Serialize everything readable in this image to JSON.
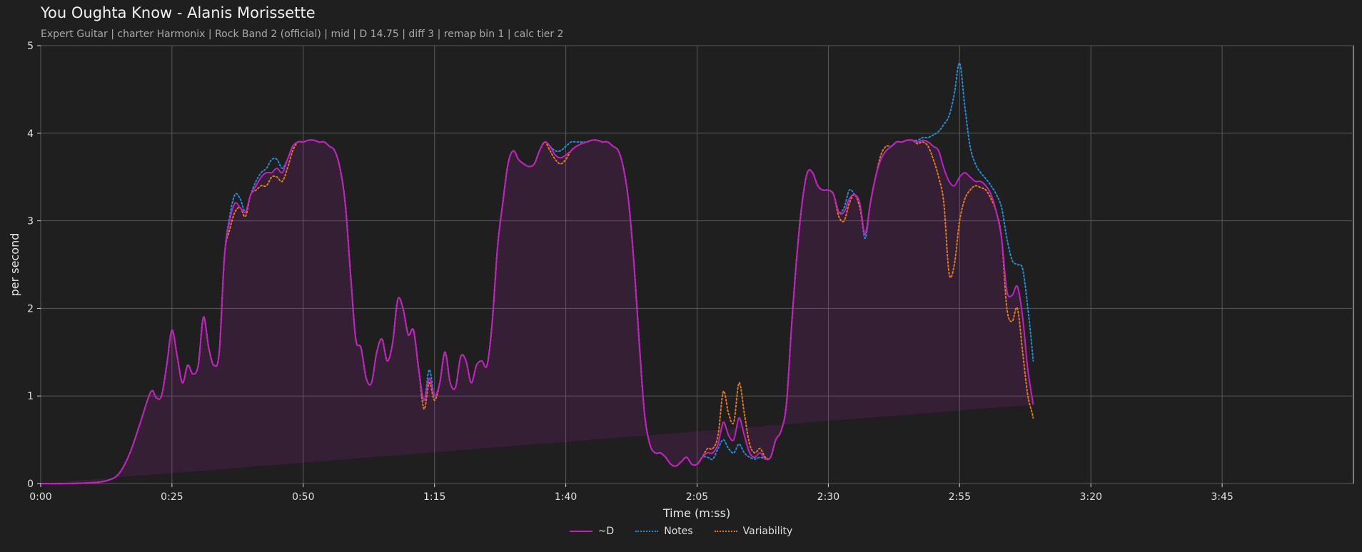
{
  "header": {
    "title": "You Oughta Know - Alanis Morissette",
    "subtitle": "Expert Guitar  |  charter Harmonix  |  Rock Band 2 (official)  |  mid  |  D 14.75  |  diff 3  |  remap bin 1  |  calc tier 2"
  },
  "chart_data": {
    "type": "line",
    "title": "You Oughta Know - Alanis Morissette",
    "xlabel": "Time (m:ss)",
    "ylabel": "per second",
    "xlim": [
      0,
      250
    ],
    "ylim": [
      0,
      5
    ],
    "x_ticks": [
      0,
      25,
      50,
      75,
      100,
      125,
      150,
      175,
      200,
      225
    ],
    "x_tick_labels": [
      "0:00",
      "0:25",
      "0:50",
      "1:15",
      "1:40",
      "2:05",
      "2:30",
      "2:55",
      "3:20",
      "3:45"
    ],
    "y_ticks": [
      0,
      1,
      2,
      3,
      4,
      5
    ],
    "y_tick_labels": [
      "0",
      "1",
      "2",
      "3",
      "4",
      "5"
    ],
    "grid": true,
    "legend_position": "bottom-center",
    "x": [
      0,
      5,
      10,
      13,
      15,
      17,
      19,
      21,
      22,
      23,
      24,
      25,
      26,
      27,
      28,
      29,
      30,
      31,
      32,
      33,
      34,
      35,
      36,
      37,
      38,
      39,
      40,
      41,
      42,
      43,
      44,
      45,
      46,
      47,
      48,
      49,
      50,
      51,
      52,
      53,
      54,
      55,
      56,
      57,
      58,
      59,
      60,
      61,
      62,
      63,
      64,
      65,
      66,
      67,
      68,
      69,
      70,
      71,
      72,
      73,
      74,
      75,
      76,
      77,
      78,
      79,
      80,
      81,
      82,
      83,
      84,
      85,
      86,
      87,
      88,
      89,
      90,
      91,
      92,
      93,
      94,
      95,
      96,
      97,
      98,
      99,
      100,
      101,
      102,
      103,
      104,
      105,
      106,
      107,
      108,
      109,
      110,
      111,
      112,
      113,
      114,
      115,
      116,
      117,
      118,
      119,
      120,
      121,
      122,
      123,
      124,
      125,
      126,
      127,
      128,
      129,
      130,
      131,
      132,
      133,
      134,
      135,
      136,
      137,
      138,
      139,
      140,
      141,
      142,
      143,
      144,
      145,
      146,
      147,
      148,
      149,
      150,
      151,
      152,
      153,
      154,
      155,
      156,
      157,
      158,
      159,
      160,
      161,
      162,
      163,
      164,
      165,
      166,
      167,
      168,
      169,
      170,
      171,
      172,
      173,
      174,
      175,
      176,
      177,
      178,
      179,
      180,
      181,
      182,
      183,
      184,
      185,
      186,
      187,
      188,
      189,
      190,
      191,
      192,
      193,
      194,
      195,
      196,
      197,
      198,
      199,
      200,
      201,
      202,
      203,
      204,
      205,
      206,
      207,
      208,
      209,
      210,
      211,
      212,
      213,
      214,
      215,
      216,
      217,
      218,
      219,
      220,
      221,
      222,
      223,
      224,
      225,
      226,
      227,
      228,
      229,
      230,
      231,
      232,
      233,
      234,
      235,
      236,
      237,
      238,
      239,
      240,
      241,
      242,
      243,
      244,
      245,
      246,
      247,
      248,
      249,
      250
    ],
    "series": [
      {
        "name": "~D",
        "color": "#c21fc4",
        "style": "solid",
        "fill": true,
        "values": [
          0,
          0,
          0.01,
          0.04,
          0.12,
          0.35,
          0.7,
          1.05,
          0.98,
          1.0,
          1.35,
          1.75,
          1.45,
          1.15,
          1.35,
          1.25,
          1.35,
          1.9,
          1.55,
          1.35,
          1.5,
          2.6,
          3.0,
          3.2,
          3.15,
          3.1,
          3.3,
          3.4,
          3.5,
          3.55,
          3.55,
          3.6,
          3.55,
          3.7,
          3.85,
          3.9,
          3.9,
          3.92,
          3.92,
          3.9,
          3.9,
          3.85,
          3.8,
          3.6,
          3.2,
          2.4,
          1.65,
          1.55,
          1.2,
          1.15,
          1.5,
          1.65,
          1.4,
          1.6,
          2.1,
          2.0,
          1.7,
          1.75,
          1.3,
          0.95,
          1.2,
          1.0,
          1.15,
          1.5,
          1.15,
          1.1,
          1.45,
          1.4,
          1.15,
          1.35,
          1.4,
          1.35,
          1.85,
          2.7,
          3.2,
          3.65,
          3.8,
          3.7,
          3.65,
          3.62,
          3.65,
          3.8,
          3.9,
          3.85,
          3.75,
          3.72,
          3.75,
          3.8,
          3.85,
          3.88,
          3.9,
          3.92,
          3.92,
          3.9,
          3.9,
          3.85,
          3.8,
          3.6,
          3.2,
          2.5,
          1.6,
          0.8,
          0.45,
          0.35,
          0.35,
          0.3,
          0.22,
          0.2,
          0.25,
          0.3,
          0.22,
          0.22,
          0.3,
          0.35,
          0.35,
          0.45,
          0.7,
          0.55,
          0.5,
          0.75,
          0.55,
          0.35,
          0.3,
          0.35,
          0.28,
          0.3,
          0.5,
          0.6,
          0.9,
          1.8,
          2.6,
          3.2,
          3.55,
          3.55,
          3.4,
          3.35,
          3.35,
          3.3,
          3.1,
          3.1,
          3.25,
          3.3,
          3.2,
          2.85,
          3.2,
          3.5,
          3.7,
          3.8,
          3.85,
          3.9,
          3.9,
          3.92,
          3.92,
          3.9,
          3.92,
          3.9,
          3.85,
          3.8,
          3.6,
          3.45,
          3.4,
          3.5,
          3.55,
          3.5,
          3.45,
          3.45,
          3.4,
          3.3,
          3.1,
          2.8,
          2.2,
          2.15,
          2.25,
          1.9,
          1.3,
          0.9,
          0.4
        ]
      },
      {
        "name": "Notes",
        "color": "#1f8fd6",
        "style": "dotted",
        "fill": false,
        "values": [
          0,
          0,
          0.01,
          0.04,
          0.12,
          0.35,
          0.7,
          1.05,
          0.98,
          1.0,
          1.35,
          1.75,
          1.45,
          1.15,
          1.35,
          1.25,
          1.35,
          1.9,
          1.55,
          1.35,
          1.5,
          2.6,
          3.05,
          3.3,
          3.25,
          3.1,
          3.3,
          3.45,
          3.55,
          3.6,
          3.7,
          3.7,
          3.6,
          3.7,
          3.85,
          3.9,
          3.9,
          3.92,
          3.92,
          3.9,
          3.9,
          3.85,
          3.8,
          3.6,
          3.2,
          2.4,
          1.65,
          1.55,
          1.2,
          1.15,
          1.5,
          1.65,
          1.4,
          1.6,
          2.1,
          2.0,
          1.7,
          1.75,
          1.3,
          0.95,
          1.3,
          1.0,
          1.15,
          1.5,
          1.15,
          1.1,
          1.45,
          1.4,
          1.15,
          1.35,
          1.4,
          1.35,
          1.85,
          2.7,
          3.2,
          3.65,
          3.8,
          3.7,
          3.65,
          3.62,
          3.65,
          3.8,
          3.9,
          3.85,
          3.8,
          3.8,
          3.85,
          3.9,
          3.9,
          3.9,
          3.9,
          3.92,
          3.92,
          3.9,
          3.9,
          3.85,
          3.8,
          3.6,
          3.2,
          2.5,
          1.6,
          0.8,
          0.45,
          0.35,
          0.35,
          0.3,
          0.22,
          0.2,
          0.25,
          0.3,
          0.22,
          0.22,
          0.3,
          0.3,
          0.28,
          0.4,
          0.5,
          0.4,
          0.35,
          0.45,
          0.35,
          0.3,
          0.28,
          0.3,
          0.28,
          0.3,
          0.5,
          0.6,
          0.9,
          1.8,
          2.6,
          3.2,
          3.55,
          3.55,
          3.4,
          3.35,
          3.35,
          3.3,
          3.1,
          3.15,
          3.35,
          3.3,
          3.2,
          2.8,
          3.2,
          3.5,
          3.7,
          3.8,
          3.85,
          3.9,
          3.9,
          3.92,
          3.92,
          3.92,
          3.95,
          3.95,
          3.98,
          4.02,
          4.1,
          4.2,
          4.45,
          4.8,
          4.3,
          3.85,
          3.65,
          3.55,
          3.48,
          3.4,
          3.3,
          3.15,
          2.8,
          2.55,
          2.5,
          2.45,
          2.0,
          1.4,
          0.5
        ]
      },
      {
        "name": "Variability",
        "color": "#e07b1a",
        "style": "dotted",
        "fill": false,
        "values": [
          0,
          0,
          0.01,
          0.04,
          0.12,
          0.35,
          0.7,
          1.05,
          0.98,
          1.0,
          1.35,
          1.75,
          1.45,
          1.15,
          1.35,
          1.25,
          1.35,
          1.9,
          1.55,
          1.35,
          1.5,
          2.6,
          2.9,
          3.1,
          3.15,
          3.05,
          3.3,
          3.35,
          3.4,
          3.4,
          3.5,
          3.5,
          3.45,
          3.6,
          3.8,
          3.9,
          3.9,
          3.92,
          3.92,
          3.9,
          3.9,
          3.85,
          3.8,
          3.6,
          3.2,
          2.4,
          1.65,
          1.55,
          1.2,
          1.15,
          1.5,
          1.65,
          1.4,
          1.6,
          2.1,
          2.0,
          1.7,
          1.75,
          1.3,
          0.85,
          1.15,
          0.95,
          1.15,
          1.5,
          1.15,
          1.1,
          1.45,
          1.4,
          1.15,
          1.35,
          1.4,
          1.35,
          1.85,
          2.7,
          3.2,
          3.65,
          3.8,
          3.7,
          3.65,
          3.62,
          3.65,
          3.8,
          3.9,
          3.8,
          3.7,
          3.65,
          3.7,
          3.8,
          3.85,
          3.88,
          3.9,
          3.92,
          3.92,
          3.9,
          3.9,
          3.85,
          3.8,
          3.6,
          3.2,
          2.5,
          1.6,
          0.8,
          0.45,
          0.35,
          0.35,
          0.3,
          0.22,
          0.2,
          0.25,
          0.3,
          0.22,
          0.22,
          0.3,
          0.4,
          0.4,
          0.55,
          1.05,
          0.8,
          0.7,
          1.15,
          0.8,
          0.45,
          0.35,
          0.4,
          0.3,
          0.3,
          0.5,
          0.6,
          0.9,
          1.8,
          2.6,
          3.2,
          3.55,
          3.55,
          3.4,
          3.35,
          3.35,
          3.3,
          3.05,
          3.0,
          3.2,
          3.3,
          3.15,
          2.85,
          3.2,
          3.5,
          3.75,
          3.85,
          3.85,
          3.9,
          3.9,
          3.92,
          3.92,
          3.88,
          3.9,
          3.85,
          3.7,
          3.5,
          3.2,
          2.4,
          2.5,
          3.0,
          3.25,
          3.35,
          3.4,
          3.38,
          3.35,
          3.25,
          3.1,
          2.8,
          2.0,
          1.85,
          2.0,
          1.5,
          1.0,
          0.75,
          0.3
        ]
      }
    ]
  }
}
